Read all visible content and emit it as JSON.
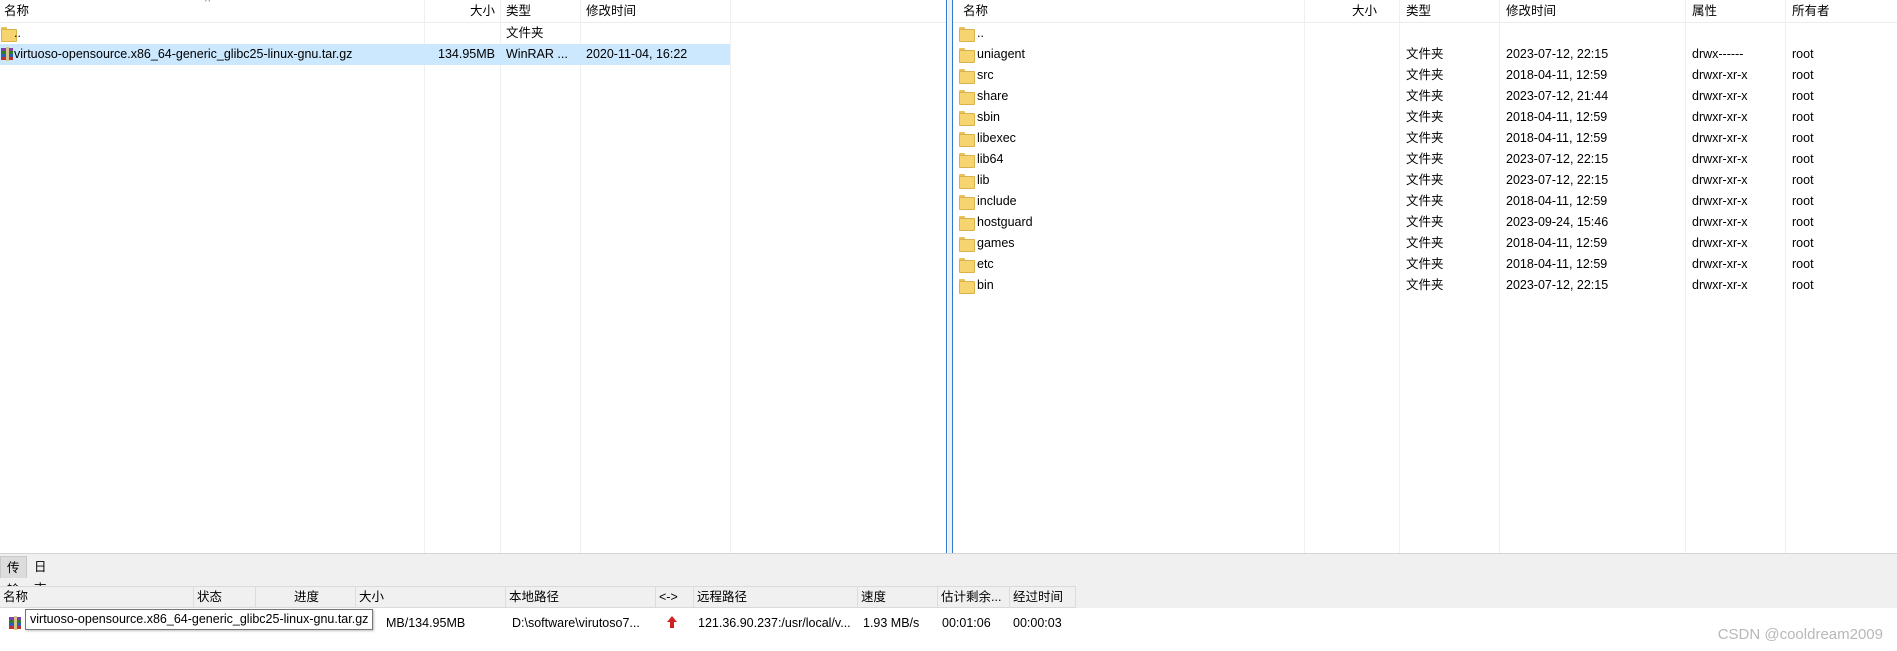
{
  "local": {
    "columns": {
      "name": "名称",
      "size": "大小",
      "type": "类型",
      "modified": "修改时间"
    },
    "rows": [
      {
        "name": "..",
        "size": "",
        "type": "文件夹",
        "modified": "",
        "icon": "folder-icon"
      },
      {
        "name": "virtuoso-opensource.x86_64-generic_glibc25-linux-gnu.tar.gz",
        "size": "134.95MB",
        "type": "WinRAR ...",
        "modified": "2020-11-04, 16:22",
        "icon": "rar-archive-icon"
      }
    ]
  },
  "remote": {
    "columns": {
      "name": "名称",
      "size": "大小",
      "type": "类型",
      "modified": "修改时间",
      "perms": "属性",
      "owner": "所有者"
    },
    "rows": [
      {
        "name": "..",
        "type": "",
        "modified": "",
        "perms": "",
        "owner": ""
      },
      {
        "name": "uniagent",
        "type": "文件夹",
        "modified": "2023-07-12, 22:15",
        "perms": "drwx------",
        "owner": "root"
      },
      {
        "name": "src",
        "type": "文件夹",
        "modified": "2018-04-11, 12:59",
        "perms": "drwxr-xr-x",
        "owner": "root"
      },
      {
        "name": "share",
        "type": "文件夹",
        "modified": "2023-07-12, 21:44",
        "perms": "drwxr-xr-x",
        "owner": "root"
      },
      {
        "name": "sbin",
        "type": "文件夹",
        "modified": "2018-04-11, 12:59",
        "perms": "drwxr-xr-x",
        "owner": "root"
      },
      {
        "name": "libexec",
        "type": "文件夹",
        "modified": "2018-04-11, 12:59",
        "perms": "drwxr-xr-x",
        "owner": "root"
      },
      {
        "name": "lib64",
        "type": "文件夹",
        "modified": "2023-07-12, 22:15",
        "perms": "drwxr-xr-x",
        "owner": "root"
      },
      {
        "name": "lib",
        "type": "文件夹",
        "modified": "2023-07-12, 22:15",
        "perms": "drwxr-xr-x",
        "owner": "root"
      },
      {
        "name": "include",
        "type": "文件夹",
        "modified": "2018-04-11, 12:59",
        "perms": "drwxr-xr-x",
        "owner": "root"
      },
      {
        "name": "hostguard",
        "type": "文件夹",
        "modified": "2023-09-24, 15:46",
        "perms": "drwxr-xr-x",
        "owner": "root"
      },
      {
        "name": "games",
        "type": "文件夹",
        "modified": "2018-04-11, 12:59",
        "perms": "drwxr-xr-x",
        "owner": "root"
      },
      {
        "name": "etc",
        "type": "文件夹",
        "modified": "2018-04-11, 12:59",
        "perms": "drwxr-xr-x",
        "owner": "root"
      },
      {
        "name": "bin",
        "type": "文件夹",
        "modified": "2023-07-12, 22:15",
        "perms": "drwxr-xr-x",
        "owner": "root"
      }
    ]
  },
  "bottom": {
    "tabs": [
      {
        "label": "传输",
        "active": true
      },
      {
        "label": "日志",
        "active": false
      }
    ],
    "queue_columns": {
      "name": "名称",
      "status": "状态",
      "progress": "进度",
      "size": "大小",
      "local_path": "本地路径",
      "direction": "<->",
      "remote_path": "远程路径",
      "speed": "速度",
      "eta": "估计剩余...",
      "elapsed": "经过时间"
    },
    "transfer": {
      "size": "MB/134.95MB",
      "local_path": "D:\\software\\virutoso7...",
      "remote_path": "121.36.90.237:/usr/local/v...",
      "speed": "1.93 MB/s",
      "eta": "00:01:06",
      "elapsed": "00:00:03",
      "direction_icon": "upload-arrow-icon"
    },
    "tooltip": "virtuoso-opensource.x86_64-generic_glibc25-linux-gnu.tar.gz"
  },
  "watermark": "CSDN @cooldream2009",
  "colors": {
    "selection": "#cce8ff",
    "pane_border": "#2f7bd0",
    "upload_arrow": "#d02020"
  }
}
